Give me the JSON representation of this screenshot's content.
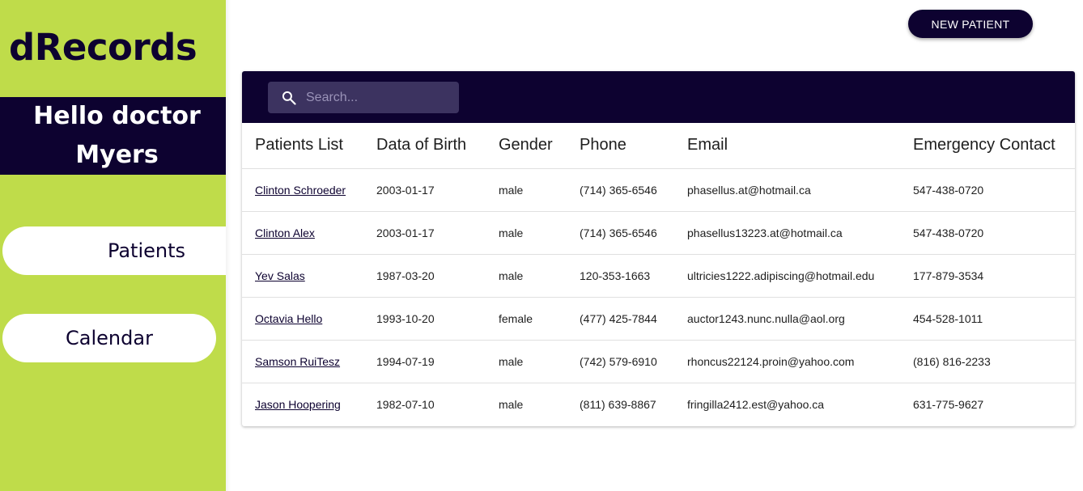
{
  "sidebar": {
    "logo": "dRecords",
    "greeting_line1": "Hello doctor",
    "greeting_line2": "Myers",
    "nav": [
      {
        "label": "Patients",
        "active": true
      },
      {
        "label": "Calendar",
        "active": false
      }
    ]
  },
  "header": {
    "new_patient_label": "NEW PATIENT"
  },
  "search": {
    "placeholder": "Search...",
    "icon": "search-icon"
  },
  "colors": {
    "sidebar_bg": "#bfdc4a",
    "primary_dark": "#0d0230",
    "search_bg": "#3c3360"
  },
  "table": {
    "columns": [
      "Patients List",
      "Data of Birth",
      "Gender",
      "Phone",
      "Email",
      "Emergency Contact"
    ],
    "rows": [
      {
        "name": "Clinton Schroeder",
        "dob": "2003-01-17",
        "gender": "male",
        "phone": "(714) 365-6546",
        "email": "phasellus.at@hotmail.ca",
        "emergency": "547-438-0720"
      },
      {
        "name": "Clinton Alex",
        "dob": "2003-01-17",
        "gender": "male",
        "phone": "(714) 365-6546",
        "email": "phasellus13223.at@hotmail.ca",
        "emergency": "547-438-0720"
      },
      {
        "name": "Yev Salas",
        "dob": "1987-03-20",
        "gender": "male",
        "phone": "120-353-1663",
        "email": "ultricies1222.adipiscing@hotmail.edu",
        "emergency": "177-879-3534"
      },
      {
        "name": "Octavia Hello",
        "dob": "1993-10-20",
        "gender": "female",
        "phone": "(477) 425-7844",
        "email": "auctor1243.nunc.nulla@aol.org",
        "emergency": "454-528-1011"
      },
      {
        "name": "Samson RuiTesz",
        "dob": "1994-07-19",
        "gender": "male",
        "phone": "(742) 579-6910",
        "email": "rhoncus22124.proin@yahoo.com",
        "emergency": "(816) 816-2233"
      },
      {
        "name": "Jason Hoopering",
        "dob": "1982-07-10",
        "gender": "male",
        "phone": "(811) 639-8867",
        "email": "fringilla2412.est@yahoo.ca",
        "emergency": "631-775-9627"
      }
    ]
  }
}
